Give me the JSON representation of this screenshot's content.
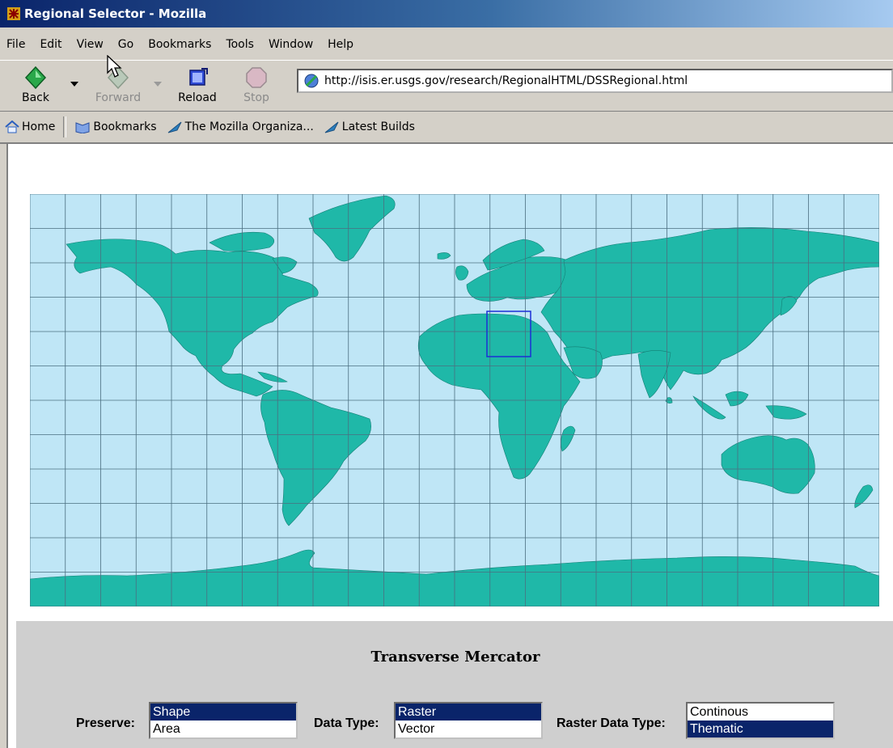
{
  "window": {
    "title": "Regional Selector - Mozilla"
  },
  "menu": [
    "File",
    "Edit",
    "View",
    "Go",
    "Bookmarks",
    "Tools",
    "Window",
    "Help"
  ],
  "toolbar": {
    "back": "Back",
    "forward": "Forward",
    "reload": "Reload",
    "stop": "Stop",
    "url": "http://isis.er.usgs.gov/research/RegionalHTML/DSSRegional.html"
  },
  "personal_toolbar": {
    "home": "Home",
    "bookmarks": "Bookmarks",
    "mozilla_org": "The Mozilla Organiza...",
    "latest_builds": "Latest Builds"
  },
  "map": {
    "ocean_color": "#bfe6f6",
    "land_color": "#1fb8a8",
    "grid_color": "#4b6f80",
    "selection_color": "#1c2fd6"
  },
  "panel": {
    "projection_name": "Transverse Mercator",
    "preserve": {
      "label": "Preserve:",
      "options": [
        "Shape",
        "Area"
      ],
      "selected": "Shape"
    },
    "data_type": {
      "label": "Data Type:",
      "options": [
        "Raster",
        "Vector"
      ],
      "selected": "Raster"
    },
    "raster_data_type": {
      "label": "Raster Data Type:",
      "options": [
        "Continous",
        "Thematic"
      ],
      "selected": "Thematic"
    }
  }
}
